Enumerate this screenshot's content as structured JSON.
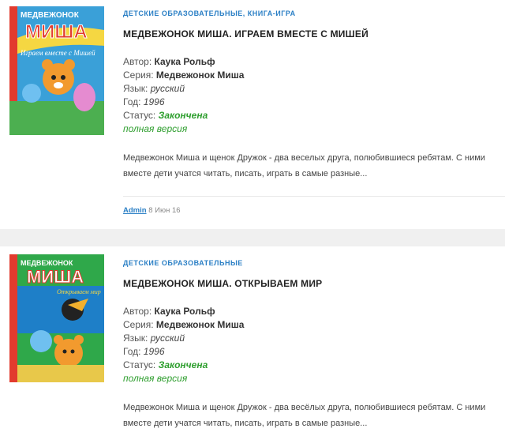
{
  "posts": [
    {
      "categories": [
        "ДЕТСКИЕ ОБРАЗОВАТЕЛЬНЫЕ",
        "КНИГА-ИГРА"
      ],
      "title": "МЕДВЕЖОНОК МИША. ИГРАЕМ ВМЕСТЕ С МИШЕЙ",
      "author_label": "Автор:",
      "author": "Каука Рольф",
      "series_label": "Серия:",
      "series": "Медвежонок Миша",
      "lang_label": "Язык:",
      "lang": "русский",
      "year_label": "Год:",
      "year": "1996",
      "status_label": "Статус:",
      "status": "Закончена",
      "version": "полная версия",
      "description": "Медвежонок Миша и щенок Дружок - два веселых друга, полюбившиеся ребятам. С ними вместе дети учатся читать, писать, играть в самые разные...",
      "post_author": "Admin",
      "date": "8 Июн 16",
      "cover_lettering": [
        "Медвежонок",
        "МИША",
        "Играем вместе с Мишей"
      ]
    },
    {
      "categories": [
        "ДЕТСКИЕ ОБРАЗОВАТЕЛЬНЫЕ"
      ],
      "title": "МЕДВЕЖОНОК МИША. ОТКРЫВАЕМ МИР",
      "author_label": "Автор:",
      "author": "Каука Рольф",
      "series_label": "Серия:",
      "series": "Медвежонок Миша",
      "lang_label": "Язык:",
      "lang": "русский",
      "year_label": "Год:",
      "year": "1996",
      "status_label": "Статус:",
      "status": "Закончена",
      "version": "полная версия",
      "description": "Медвежонок Миша и щенок Дружок - два весёлых друга, полюбившиеся ребятам. С ними вместе дети учатся читать, писать, играть в самые разные...",
      "cover_lettering": [
        "Медвежонок",
        "МИША",
        "Открываем мир"
      ]
    }
  ],
  "colors": {
    "link": "#2a7fc5",
    "status": "#2e9e2e"
  }
}
